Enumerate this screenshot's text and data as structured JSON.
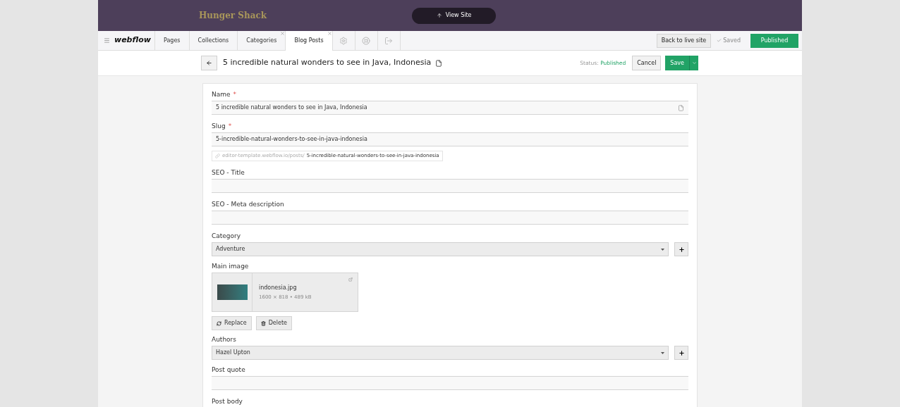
{
  "site_bar": {
    "site_title": "Hunger Shack",
    "view_site": "View Site"
  },
  "toolbar": {
    "logo": "webflow",
    "tabs": [
      {
        "label": "Pages",
        "selected": false,
        "closable": false
      },
      {
        "label": "Collections",
        "selected": false,
        "closable": false
      },
      {
        "label": "Categories",
        "selected": false,
        "closable": true
      },
      {
        "label": "Blog Posts",
        "selected": true,
        "closable": true
      }
    ],
    "back_to_live": "Back to live site",
    "saved": "Saved",
    "published": "Published"
  },
  "header": {
    "title": "5 incredible natural wonders to see in Java, Indonesia",
    "status_label": "Status:",
    "status_value": "Published",
    "cancel": "Cancel",
    "save": "Save"
  },
  "fields": [
    {
      "kind": "text",
      "label": "Name",
      "required_mark": "*",
      "value": "5 incredible natural wonders to see in Java, Indonesia"
    },
    {
      "kind": "slug",
      "label": "Slug",
      "required_mark": "*",
      "value": "5-incredible-natural-wonders-to-see-in-java-indonesia",
      "url_base": "editor-template.webflow.io/posts/",
      "url_slug": "5-incredible-natural-wonders-to-see-in-java-indonesia"
    },
    {
      "kind": "text",
      "label": "SEO - Title"
    },
    {
      "kind": "text",
      "label": "SEO - Meta description"
    },
    {
      "kind": "select",
      "label": "Category",
      "value": "Adventure"
    },
    {
      "kind": "image",
      "label": "Main image",
      "file_name": "indonesia.jpg",
      "file_meta": "1600 × 818 • 489 kB",
      "replace": "Replace",
      "delete": "Delete"
    },
    {
      "kind": "select",
      "label": "Authors",
      "value": "Hazel Upton"
    },
    {
      "kind": "text",
      "label": "Post quote"
    },
    {
      "kind": "label",
      "label": "Post body"
    }
  ]
}
